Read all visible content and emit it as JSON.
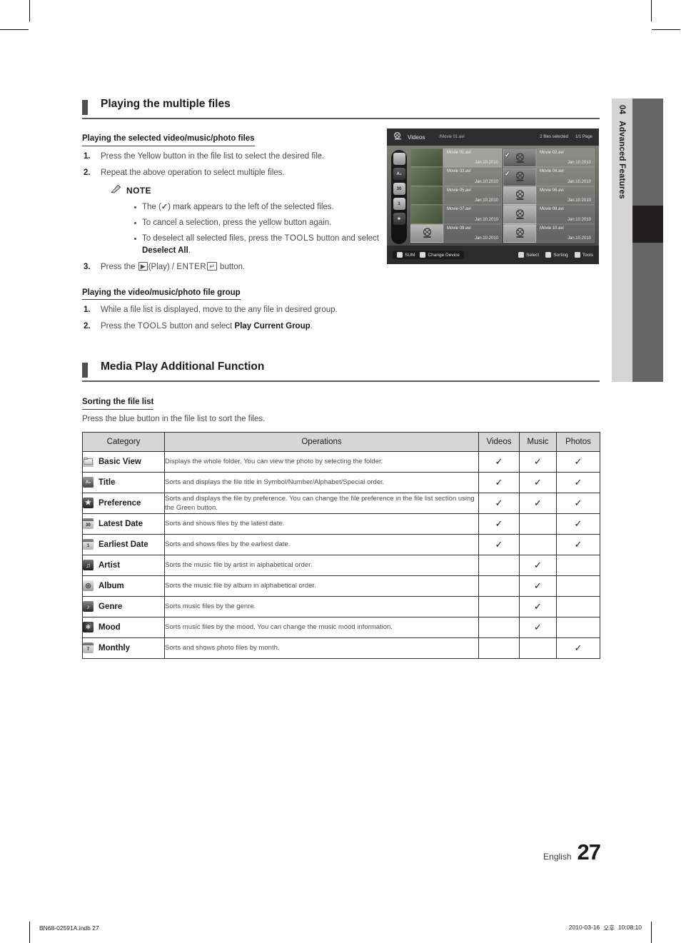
{
  "page": {
    "chapter_number": "04",
    "chapter_title": "Advanced Features",
    "language": "English",
    "number": "27",
    "print_file": "BN68-02591A.indb   27",
    "print_date": "2010-03-16",
    "print_marker": "오후",
    "print_time": "10:08:10"
  },
  "section1": {
    "title": "Playing the multiple files",
    "sub1": {
      "heading": "Playing the selected video/music/photo files",
      "step1": "Press the Yellow button in the file list to select the desired file.",
      "step1_num": "1.",
      "step2": "Repeat the above operation to select multiple files.",
      "step2_num": "2.",
      "step3_num": "3.",
      "note_label": "NOTE",
      "note1_a": "The (",
      "note1_check": "✓",
      "note1_b": ") mark appears to the left of the selected files.",
      "note2": "To cancel a selection, press the yellow button again.",
      "note3_a": "To deselect all selected files, press the ",
      "note3_tools": "TOOLS",
      "note3_b": " button and select ",
      "note3_deselect": "Deselect All",
      "note3_c": ".",
      "step3_a": "Press the ",
      "step3_play_icon": "▶",
      "step3_b": "(Play) / ",
      "step3_enter": "ENTER",
      "step3_enter_icon": "↵",
      "step3_c": " button."
    },
    "sub2": {
      "heading": "Playing the video/music/photo file group",
      "step1_num": "1.",
      "step1": "While a file list is displayed, move to the any file in desired group.",
      "step2_num": "2.",
      "step2_a": "Press the ",
      "step2_tools": "TOOLS",
      "step2_b": " button and select ",
      "step2_bold": "Play Current Group",
      "step2_c": "."
    }
  },
  "section2": {
    "title": "Media Play Additional Function",
    "sub_heading": "Sorting the file list",
    "intro": "Press the blue button in the file list to sort the files."
  },
  "tv_screenshot": {
    "header": {
      "title": "Videos",
      "path": "/Movie 01.avi",
      "files_selected": "2 files selected",
      "page": "1/1 Page"
    },
    "sidebar_icons": [
      "folder-icon",
      "az-sort-icon",
      "calendar-30-icon",
      "calendar-1-icon",
      "star-icon"
    ],
    "files": [
      {
        "name": "Movie 01.avi",
        "date": "Jan.10.2010",
        "thumb": "photo",
        "selected": false,
        "highlighted": true
      },
      {
        "name": "Movie 02.avi",
        "date": "Jan.10.2010",
        "thumb": "reel",
        "selected": true,
        "highlighted": false
      },
      {
        "name": "Movie 03.avi",
        "date": "Jan.10.2010",
        "thumb": "photo",
        "selected": false,
        "highlighted": false
      },
      {
        "name": "Movie 04.avi",
        "date": "Jan.10.2010",
        "thumb": "reel",
        "selected": true,
        "highlighted": false
      },
      {
        "name": "Movie 05.avi",
        "date": "Jan.10.2010",
        "thumb": "photo",
        "selected": false,
        "highlighted": false
      },
      {
        "name": "Movie 06.avi",
        "date": "Jan.10.2010",
        "thumb": "reel",
        "selected": false,
        "highlighted": false
      },
      {
        "name": "Movie 07.avi",
        "date": "Jan.10.2010",
        "thumb": "photo",
        "selected": false,
        "highlighted": false
      },
      {
        "name": "Movie 08.avi",
        "date": "Jan.10.2010",
        "thumb": "reel",
        "selected": false,
        "highlighted": false
      },
      {
        "name": "Movie 09.avi",
        "date": "Jan.10.2010",
        "thumb": "reel",
        "selected": false,
        "highlighted": false
      },
      {
        "name": "Movie 10.avi",
        "date": "Jan.10.2010",
        "thumb": "reel",
        "selected": false,
        "highlighted": false
      }
    ],
    "footer_left": [
      {
        "key": "",
        "label": "SUM"
      },
      {
        "key": "A",
        "label": "Change Device"
      }
    ],
    "footer_right": [
      {
        "key": "C",
        "label": "Select"
      },
      {
        "key": "D",
        "label": "Sorting"
      },
      {
        "key": "♪",
        "label": "Tools"
      }
    ]
  },
  "table": {
    "headers": [
      "Category",
      "Operations",
      "Videos",
      "Music",
      "Photos"
    ],
    "rows": [
      {
        "icon": "folder-icon",
        "icon_text": "",
        "category": "Basic View",
        "operation": "Displays the whole folder. You can view the photo by selecting the folder.",
        "videos": "✓",
        "music": "✓",
        "photos": "✓"
      },
      {
        "icon": "az-sort-icon",
        "icon_text": "A₂",
        "category": "Title",
        "operation": "Sorts and displays the file title in Symbol/Number/Alphabet/Special order.",
        "videos": "✓",
        "music": "✓",
        "photos": "✓"
      },
      {
        "icon": "star-icon",
        "icon_text": "★",
        "category": "Preference",
        "operation": "Sorts and displays the file by preference. You can change the file preference in the file list section using the Green button.",
        "videos": "✓",
        "music": "✓",
        "photos": "✓"
      },
      {
        "icon": "calendar-30-icon",
        "icon_text": "30",
        "category": "Latest Date",
        "operation": "Sorts and shows files by the latest date.",
        "videos": "✓",
        "music": "",
        "photos": "✓"
      },
      {
        "icon": "calendar-1-icon",
        "icon_text": "1",
        "category": "Earliest Date",
        "operation": "Sorts and shows files by the earliest date.",
        "videos": "✓",
        "music": "",
        "photos": "✓"
      },
      {
        "icon": "artist-icon",
        "icon_text": "♫",
        "category": "Artist",
        "operation": "Sorts the music file by artist in alphabetical order.",
        "videos": "",
        "music": "✓",
        "photos": ""
      },
      {
        "icon": "album-icon",
        "icon_text": "◎",
        "category": "Album",
        "operation": "Sorts the music file by album in alphabetical order.",
        "videos": "",
        "music": "✓",
        "photos": ""
      },
      {
        "icon": "genre-icon",
        "icon_text": "♪",
        "category": "Genre",
        "operation": "Sorts music files by the genre.",
        "videos": "",
        "music": "✓",
        "photos": ""
      },
      {
        "icon": "mood-icon",
        "icon_text": "✻",
        "category": "Mood",
        "operation": "Sorts music files by the mood. You can change the music mood information.",
        "videos": "",
        "music": "✓",
        "photos": ""
      },
      {
        "icon": "calendar-7-icon",
        "icon_text": "7",
        "category": "Monthly",
        "operation": "Sorts and shows photo files by month.",
        "videos": "",
        "music": "",
        "photos": "✓"
      }
    ]
  }
}
